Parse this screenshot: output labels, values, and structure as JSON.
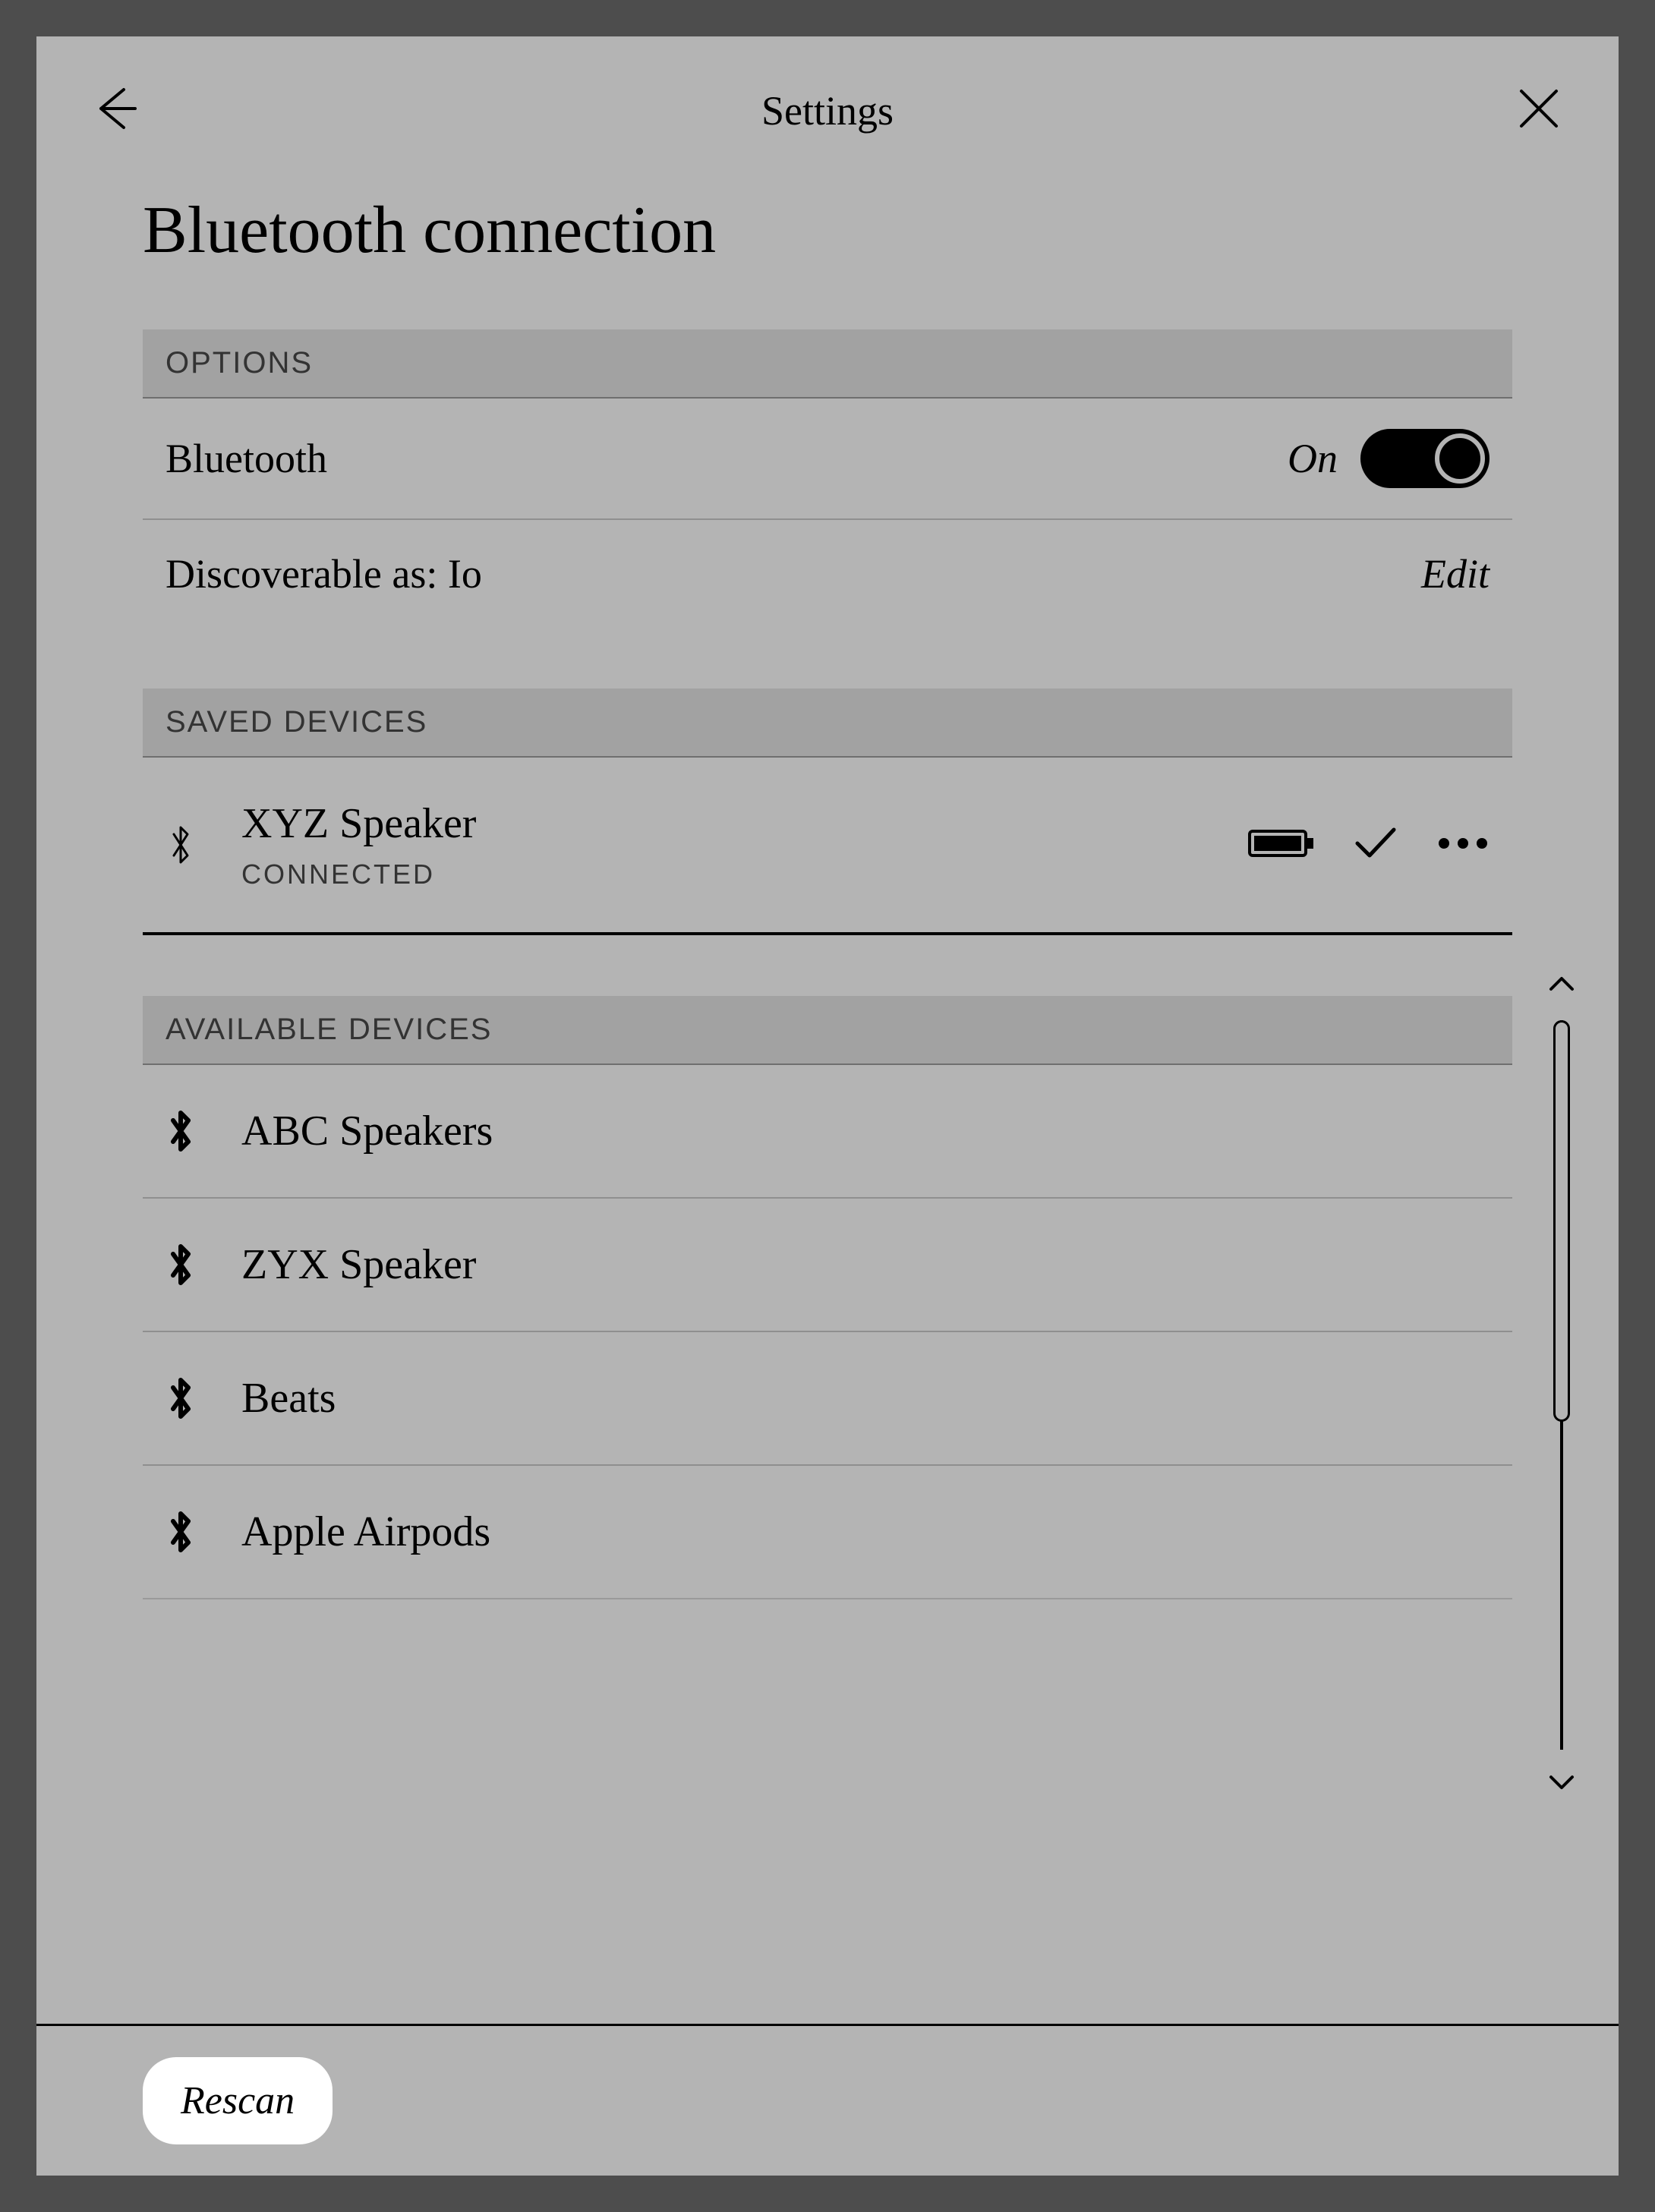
{
  "header": {
    "title": "Settings"
  },
  "page": {
    "heading": "Bluetooth connection"
  },
  "sections": {
    "options_header": "OPTIONS",
    "saved_header": "SAVED DEVICES",
    "available_header": "AVAILABLE DEVICES"
  },
  "bluetooth": {
    "label": "Bluetooth",
    "state_text": "On",
    "state": true
  },
  "discoverable": {
    "label": "Discoverable as: Io",
    "edit_label": "Edit"
  },
  "saved_devices": [
    {
      "name": "XYZ Speaker",
      "status": "CONNECTED"
    }
  ],
  "available_devices": [
    {
      "name": "ABC Speakers"
    },
    {
      "name": "ZYX Speaker"
    },
    {
      "name": "Beats"
    },
    {
      "name": "Apple Airpods"
    }
  ],
  "footer": {
    "rescan_label": "Rescan"
  }
}
